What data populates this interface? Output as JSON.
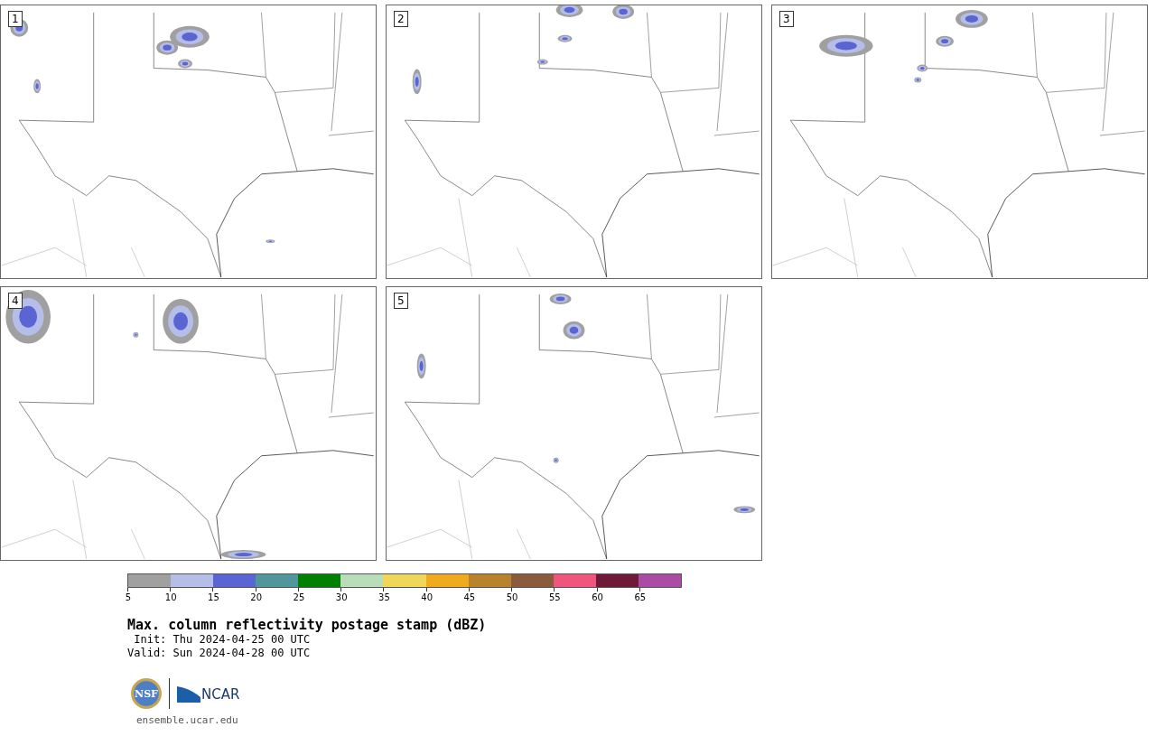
{
  "panels": [
    {
      "number": "1"
    },
    {
      "number": "2"
    },
    {
      "number": "3"
    },
    {
      "number": "4"
    },
    {
      "number": "5"
    }
  ],
  "colorbar": {
    "segments": [
      {
        "color": "#a0a0a0"
      },
      {
        "color": "#b4bee8"
      },
      {
        "color": "#5a64d2"
      },
      {
        "color": "#50969b"
      },
      {
        "color": "#008000"
      },
      {
        "color": "#b9dcb9"
      },
      {
        "color": "#f0d75a"
      },
      {
        "color": "#f0aa1e"
      },
      {
        "color": "#b9822d"
      },
      {
        "color": "#8c5a3c"
      },
      {
        "color": "#f0557d"
      },
      {
        "color": "#6e1937"
      },
      {
        "color": "#aa4ba5"
      }
    ],
    "ticks": [
      "5",
      "10",
      "15",
      "20",
      "25",
      "30",
      "35",
      "40",
      "45",
      "50",
      "55",
      "60",
      "65"
    ]
  },
  "title": "Max. column reflectivity postage stamp (dBZ)",
  "init": " Init: Thu 2024-04-25 00 UTC",
  "valid": "Valid: Sun 2024-04-28 00 UTC",
  "logos": {
    "nsf": "NSF",
    "ncar": "NCAR"
  },
  "url": "ensemble.ucar.edu"
}
